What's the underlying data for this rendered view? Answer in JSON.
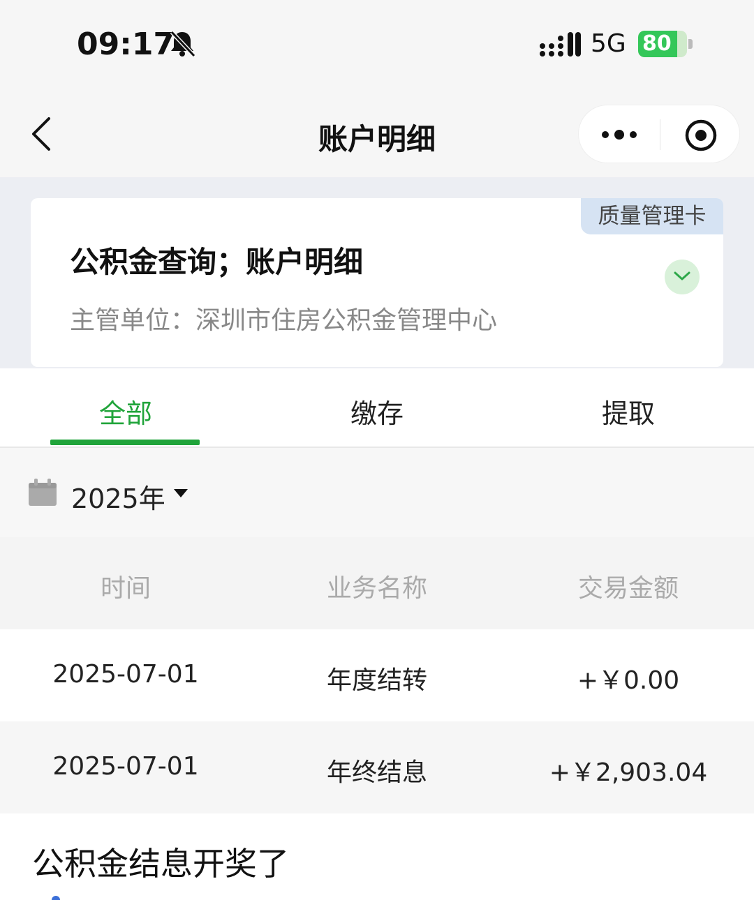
{
  "status_bar": {
    "time": "09:17",
    "network": "5G",
    "battery": "80",
    "battery_level_percent": 80,
    "icons": [
      "bell-slash-icon",
      "signal-icon",
      "battery-charging-icon"
    ]
  },
  "nav": {
    "title": "账户明细",
    "icons": [
      "back-chevron-icon",
      "more-dots-icon",
      "target-icon"
    ]
  },
  "card": {
    "badge": "质量管理卡",
    "title": "公积金查询；账户明细",
    "subtitle": "主管单位：深圳市住房公积金管理中心",
    "icon": "chevron-down-icon"
  },
  "tabs": [
    {
      "label": "全部",
      "active": true
    },
    {
      "label": "缴存",
      "active": false
    },
    {
      "label": "提取",
      "active": false
    }
  ],
  "filter": {
    "year": "2025年",
    "icons": [
      "calendar-icon",
      "caret-down-icon"
    ]
  },
  "table": {
    "headers": [
      "时间",
      "业务名称",
      "交易金额"
    ],
    "rows": [
      {
        "date": "2025-07-01",
        "name": "年度结转",
        "amount": "+￥0.00"
      },
      {
        "date": "2025-07-01",
        "name": "年终结息",
        "amount": "+￥2,903.04"
      }
    ]
  },
  "caption": "公积金结息开奖了",
  "colors": {
    "accent": "#20a43a",
    "badge_bg": "#d6e3f3",
    "battery": "#34c759"
  }
}
